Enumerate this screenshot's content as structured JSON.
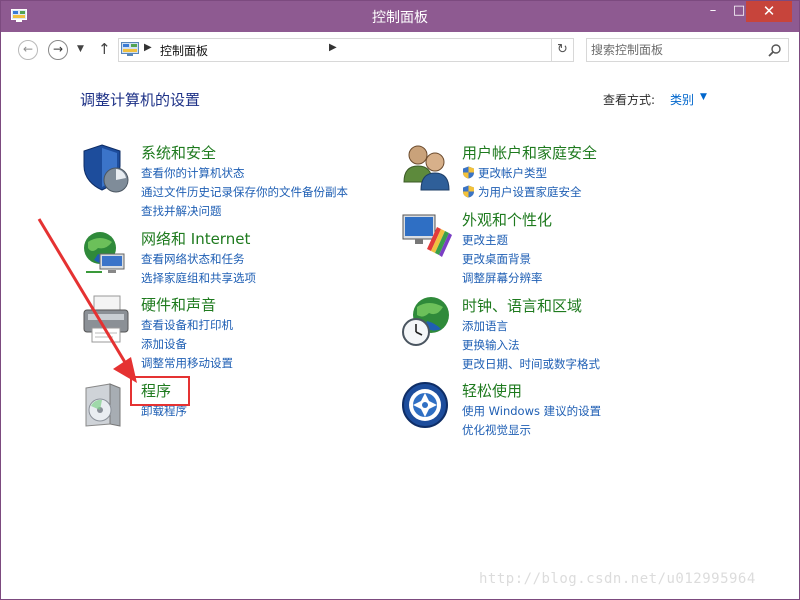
{
  "window": {
    "title": "控制面板",
    "minimize_glyph": "–",
    "maximize_glyph": "□",
    "close_glyph": "✕"
  },
  "nav": {
    "back_glyph": "←",
    "forward_glyph": "→",
    "recent_glyph": "▼",
    "up_glyph": "↑",
    "breadcrumb": "控制面板",
    "breadcrumb_sep": "▶",
    "dropdown_glyph": "▼",
    "refresh_glyph": "↻",
    "search_placeholder": "搜索控制面板"
  },
  "header": {
    "title": "调整计算机的设置",
    "view_by_label": "查看方式:",
    "view_by_value": "类别",
    "view_by_arrow": "▼"
  },
  "categories": [
    {
      "title": "系统和安全",
      "icon": "shield-icon",
      "links": [
        "查看你的计算机状态",
        "通过文件历史记录保存你的文件备份副本",
        "查找并解决问题"
      ]
    },
    {
      "title": "网络和 Internet",
      "icon": "network-globe-icon",
      "links": [
        "查看网络状态和任务",
        "选择家庭组和共享选项"
      ]
    },
    {
      "title": "硬件和声音",
      "icon": "printer-icon",
      "links": [
        "查看设备和打印机",
        "添加设备",
        "调整常用移动设置"
      ]
    },
    {
      "title": "程序",
      "icon": "programs-icon",
      "links": [
        "卸载程序"
      ]
    },
    {
      "title": "用户帐户和家庭安全",
      "icon": "users-icon",
      "links": [
        "更改帐户类型",
        "为用户设置家庭安全"
      ]
    },
    {
      "title": "外观和个性化",
      "icon": "monitor-palette-icon",
      "links": [
        "更改主题",
        "更改桌面背景",
        "调整屏幕分辨率"
      ]
    },
    {
      "title": "时钟、语言和区域",
      "icon": "clock-globe-icon",
      "links": [
        "添加语言",
        "更换输入法",
        "更改日期、时间或数字格式"
      ]
    },
    {
      "title": "轻松使用",
      "icon": "ease-of-access-icon",
      "links": [
        "使用 Windows 建议的设置",
        "优化视觉显示"
      ]
    }
  ],
  "watermark": "http://blog.csdn.net/u012995964",
  "colors": {
    "titlebar": "#8e5a91",
    "close": "#c7443b",
    "category_title": "#1e7a1e",
    "link": "#1f5fb4",
    "heading": "#1e3287",
    "annotation": "#e53232"
  }
}
